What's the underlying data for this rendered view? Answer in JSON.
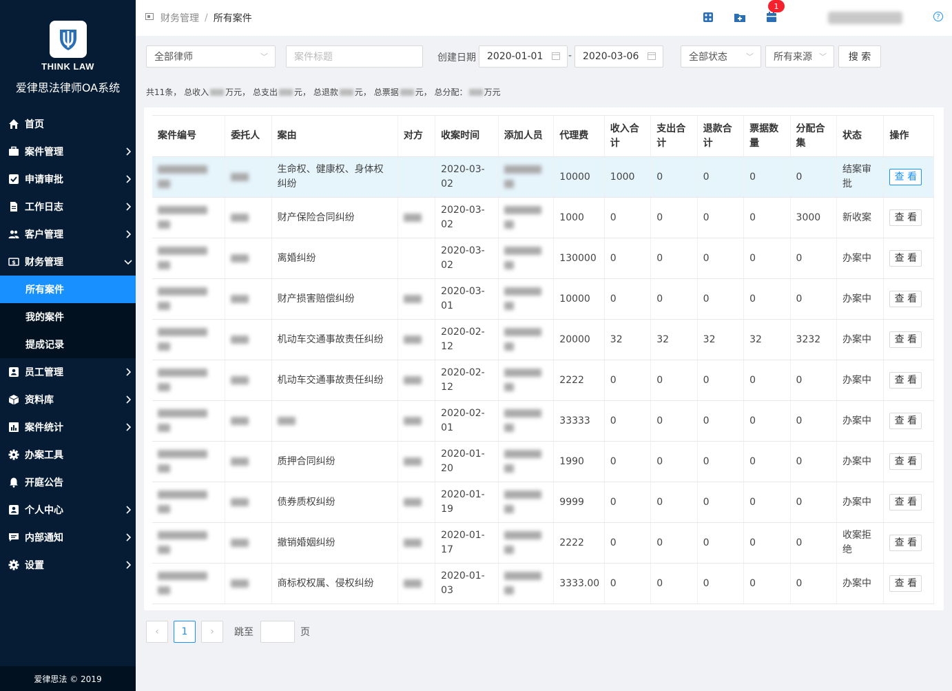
{
  "sidebar": {
    "logo_text": "THINK LAW",
    "system_title": "爱律思法律师OA系统",
    "items": [
      {
        "label": "首页",
        "icon": "home-icon",
        "arrow": ""
      },
      {
        "label": "案件管理",
        "icon": "briefcase-icon",
        "arrow": "right"
      },
      {
        "label": "申请审批",
        "icon": "checkbox-icon",
        "arrow": "right"
      },
      {
        "label": "工作日志",
        "icon": "document-icon",
        "arrow": "right"
      },
      {
        "label": "客户管理",
        "icon": "users-icon",
        "arrow": "right"
      },
      {
        "label": "财务管理",
        "icon": "finance-icon",
        "arrow": "down"
      }
    ],
    "sub_items": [
      {
        "label": "所有案件",
        "active": true
      },
      {
        "label": "我的案件",
        "active": false
      },
      {
        "label": "提成记录",
        "active": false
      }
    ],
    "items2": [
      {
        "label": "员工管理",
        "icon": "id-card-icon",
        "arrow": "right"
      },
      {
        "label": "资料库",
        "icon": "box-icon",
        "arrow": "right"
      },
      {
        "label": "案件统计",
        "icon": "bar-chart-icon",
        "arrow": "right"
      },
      {
        "label": "办案工具",
        "icon": "gear-icon",
        "arrow": ""
      },
      {
        "label": "开庭公告",
        "icon": "bell-icon",
        "arrow": ""
      },
      {
        "label": "个人中心",
        "icon": "profile-icon",
        "arrow": "right"
      },
      {
        "label": "内部通知",
        "icon": "message-icon",
        "arrow": "right"
      },
      {
        "label": "设置",
        "icon": "settings-icon",
        "arrow": "right"
      }
    ],
    "footer": "爱律思法 © 2019"
  },
  "breadcrumb": {
    "parent": "财务管理",
    "separator": "/",
    "current": "所有案件"
  },
  "topbar": {
    "notification_count": "1"
  },
  "filters": {
    "lawyer": "全部律师",
    "title_placeholder": "案件标题",
    "date_label": "创建日期",
    "date_from": "2020-01-01",
    "date_sep": "-",
    "date_to": "2020-03-06",
    "status": "全部状态",
    "source": "所有来源",
    "search_label": "搜 索"
  },
  "summary": {
    "count": "共11条，",
    "income": "总收入",
    "income_unit": "万元，",
    "expense": "总支出",
    "expense_unit": "元，",
    "refund": "总退款",
    "refund_unit": "元，",
    "tickets": "总票据",
    "tickets_unit": "元，",
    "distribution": "总分配：",
    "distribution_unit": "万元"
  },
  "table": {
    "headers": [
      "案件编号",
      "委托人",
      "案由",
      "对方",
      "收案时间",
      "添加人员",
      "代理费",
      "收入合计",
      "支出合计",
      "退款合计",
      "票据数量",
      "分配合集",
      "状态",
      "操作"
    ],
    "view_label": "查 看",
    "rows": [
      {
        "cause": "生命权、健康权、身体权纠纷",
        "date": "2020-03-02",
        "fee": "10000",
        "income": "1000",
        "expense": "0",
        "refund": "0",
        "tickets": "0",
        "dist": "0",
        "status": "结案审批"
      },
      {
        "cause": "财产保险合同纠纷",
        "date": "2020-03-02",
        "fee": "1000",
        "income": "0",
        "expense": "0",
        "refund": "0",
        "tickets": "0",
        "dist": "3000",
        "status": "新收案"
      },
      {
        "cause": "离婚纠纷",
        "date": "2020-03-02",
        "fee": "130000",
        "income": "0",
        "expense": "0",
        "refund": "0",
        "tickets": "0",
        "dist": "0",
        "status": "办案中"
      },
      {
        "cause": "财产损害赔偿纠纷",
        "date": "2020-03-01",
        "fee": "10000",
        "income": "0",
        "expense": "0",
        "refund": "0",
        "tickets": "0",
        "dist": "0",
        "status": "办案中"
      },
      {
        "cause": "机动车交通事故责任纠纷",
        "date": "2020-02-12",
        "fee": "20000",
        "income": "32",
        "expense": "32",
        "refund": "32",
        "tickets": "32",
        "dist": "3232",
        "status": "办案中"
      },
      {
        "cause": "机动车交通事故责任纠纷",
        "date": "2020-02-12",
        "fee": "2222",
        "income": "0",
        "expense": "0",
        "refund": "0",
        "tickets": "0",
        "dist": "0",
        "status": "办案中"
      },
      {
        "cause": "",
        "date": "2020-02-01",
        "fee": "33333",
        "income": "0",
        "expense": "0",
        "refund": "0",
        "tickets": "0",
        "dist": "0",
        "status": "办案中"
      },
      {
        "cause": "质押合同纠纷",
        "date": "2020-01-20",
        "fee": "1990",
        "income": "0",
        "expense": "0",
        "refund": "0",
        "tickets": "0",
        "dist": "0",
        "status": "办案中"
      },
      {
        "cause": "债券质权纠纷",
        "date": "2020-01-19",
        "fee": "9999",
        "income": "0",
        "expense": "0",
        "refund": "0",
        "tickets": "0",
        "dist": "0",
        "status": "办案中"
      },
      {
        "cause": "撤销婚姻纠纷",
        "date": "2020-01-17",
        "fee": "2222",
        "income": "0",
        "expense": "0",
        "refund": "0",
        "tickets": "0",
        "dist": "0",
        "status": "收案拒绝"
      },
      {
        "cause": "商标权权属、侵权纠纷",
        "date": "2020-01-03",
        "fee": "3333.00",
        "income": "0",
        "expense": "0",
        "refund": "0",
        "tickets": "0",
        "dist": "0",
        "status": "办案中"
      }
    ]
  },
  "pagination": {
    "prev": "‹",
    "current": "1",
    "next": "›",
    "jump_label": "跳至",
    "page_label": "页"
  },
  "colors": {
    "sidebar_bg": "#061b34",
    "accent": "#1890ff",
    "highlight_row": "#e6f4fc",
    "badge": "#f5222d"
  }
}
